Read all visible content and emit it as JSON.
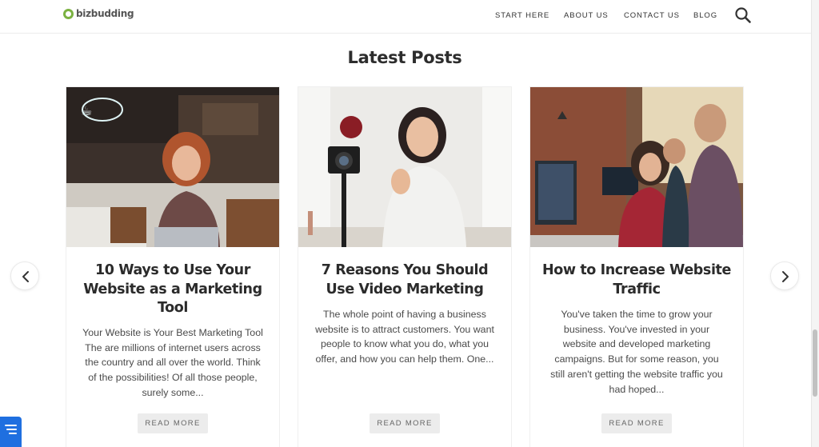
{
  "header": {
    "logo_text": "bizbudding",
    "nav": [
      {
        "label": "START HERE"
      },
      {
        "label": "ABOUT US"
      },
      {
        "label": "CONTACT US"
      },
      {
        "label": "BLOG"
      }
    ],
    "search_icon": "magnifier-icon"
  },
  "section": {
    "title": "Latest Posts"
  },
  "posts": [
    {
      "image": "woman-laptop-cafe-photo",
      "title": "10 Ways to Use Your Website as a Marketing Tool",
      "excerpt": "Your Website is Your Best Marketing Tool The are millions of internet users across the country and all over the world. Think of the possibilities! Of all those people, surely some...",
      "button": "READ MORE"
    },
    {
      "image": "woman-vlogging-camera-photo",
      "title": "7 Reasons You Should Use Video Marketing",
      "excerpt": "The whole point of having a business website is to attract customers. You want people to know what you do, what you offer, and how you can help them. One...",
      "button": "READ MORE"
    },
    {
      "image": "team-at-computer-photo",
      "title": "How to Increase Website Traffic",
      "excerpt": "You've taken the time to grow your business. You've invested in your website and developed marketing campaigns. But for some reason, you still aren't getting the website traffic you had hoped...",
      "button": "READ MORE"
    }
  ],
  "carousel": {
    "prev_icon": "chevron-left-icon",
    "next_icon": "chevron-right-icon"
  },
  "widget": {
    "icon": "chat-lines-icon",
    "color": "#1f6fe0"
  }
}
